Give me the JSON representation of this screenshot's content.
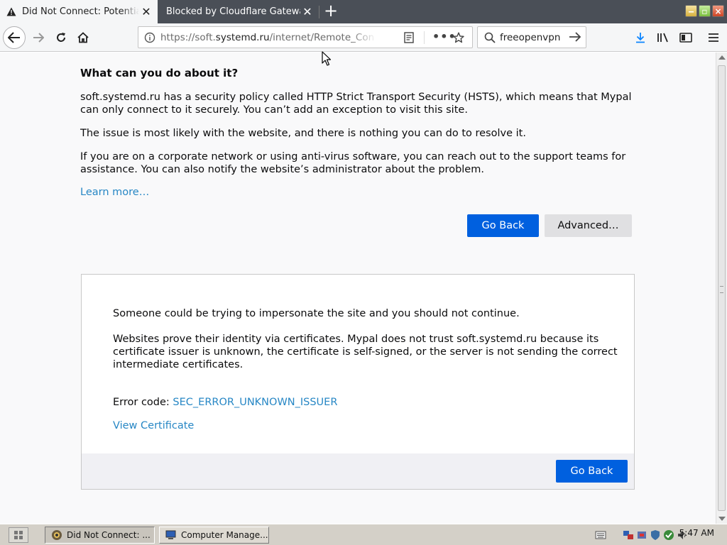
{
  "tabs": [
    {
      "title": "Did Not Connect: Potential Security Issue",
      "active": true
    },
    {
      "title": "Blocked by Cloudflare Gateway",
      "active": false
    }
  ],
  "urlbar": {
    "prefix": "https://soft.",
    "host": "systemd.ru",
    "path": "/internet/Remote_Con"
  },
  "searchbar": {
    "value": "freeopenvpn"
  },
  "page": {
    "heading": "What can you do about it?",
    "p1": "soft.systemd.ru has a security policy called HTTP Strict Transport Security (HSTS), which means that Mypal can only connect to it securely. You can’t add an exception to visit this site.",
    "p2": "The issue is most likely with the website, and there is nothing you can do to resolve it.",
    "p3": "If you are on a corporate network or using anti-virus software, you can reach out to the support teams for assistance. You can also notify the website’s administrator about the problem.",
    "learn_more": "Learn more…",
    "go_back": "Go Back",
    "advanced": "Advanced…"
  },
  "advanced_panel": {
    "p1": "Someone could be trying to impersonate the site and you should not continue.",
    "p2": "Websites prove their identity via certificates. Mypal does not trust soft.systemd.ru because its certificate issuer is unknown, the certificate is self-signed, or the server is not sending the correct intermediate certificates.",
    "error_label": "Error code: ",
    "error_code": "SEC_ERROR_UNKNOWN_ISSUER",
    "view_certificate": "View Certificate",
    "go_back": "Go Back"
  },
  "taskbar": {
    "tasks": [
      {
        "label": "Did Not Connect: ...",
        "active": true
      },
      {
        "label": "Computer Manage...",
        "active": false
      }
    ],
    "clock": "5:47 AM"
  },
  "colors": {
    "accent": "#0060df",
    "link": "#2787c5",
    "tabstrip": "#4a4f57"
  }
}
